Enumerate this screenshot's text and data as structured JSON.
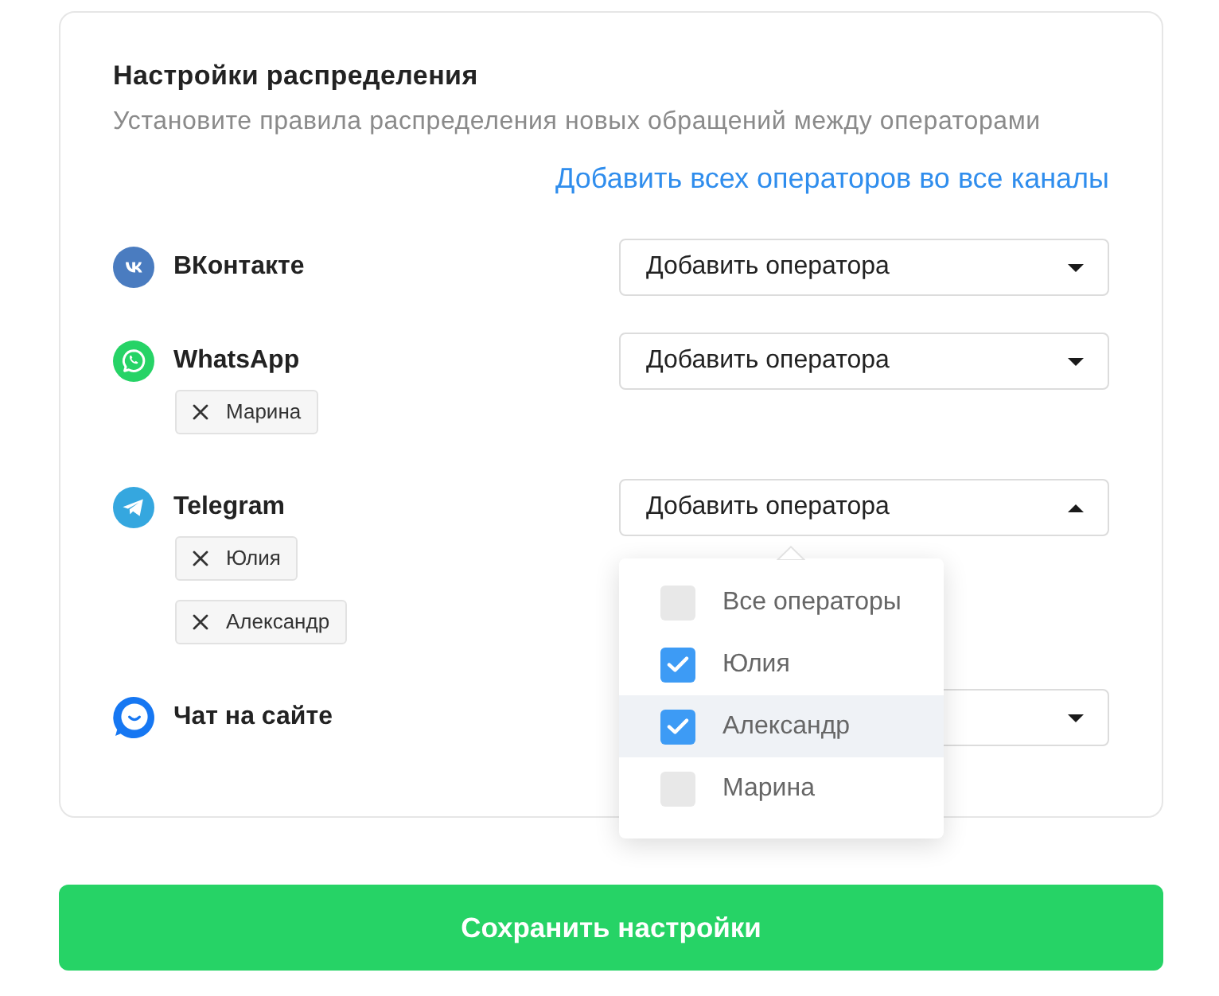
{
  "panel": {
    "title": "Настройки распределения",
    "subtitle": "Установите правила распределения новых обращений между операторами",
    "add_all_link": "Добавить всех операторов во все каналы"
  },
  "channels": [
    {
      "kind": "vk",
      "name": "ВКонтакте",
      "select_label": "Добавить оператора",
      "expanded": false
    },
    {
      "kind": "whatsapp",
      "name": "WhatsApp",
      "select_label": "Добавить оператора",
      "expanded": false,
      "operators": [
        "Марина"
      ]
    },
    {
      "kind": "telegram",
      "name": "Telegram",
      "select_label": "Добавить оператора",
      "expanded": true,
      "operators": [
        "Юлия",
        "Александр"
      ],
      "menu": [
        {
          "label": "Все операторы",
          "checked": false,
          "highlighted": false
        },
        {
          "label": "Юлия",
          "checked": true,
          "highlighted": false
        },
        {
          "label": "Александр",
          "checked": true,
          "highlighted": true
        },
        {
          "label": "Марина",
          "checked": false,
          "highlighted": false
        }
      ]
    },
    {
      "kind": "site_chat",
      "name": "Чат на сайте",
      "expanded": false
    }
  ],
  "save_button": "Сохранить настройки"
}
